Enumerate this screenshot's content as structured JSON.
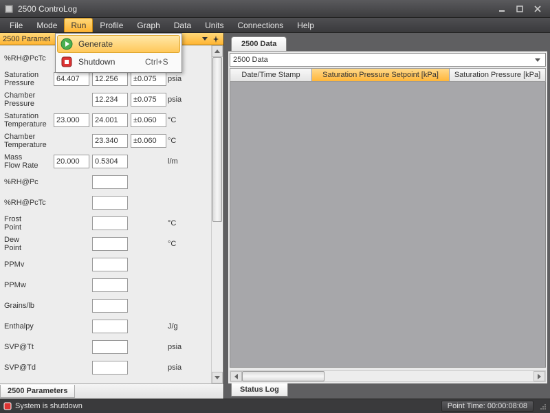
{
  "window": {
    "title": "2500 ControLog"
  },
  "menu": {
    "items": [
      "File",
      "Mode",
      "Run",
      "Profile",
      "Graph",
      "Data",
      "Units",
      "Connections",
      "Help"
    ],
    "active_index": 2
  },
  "run_menu": {
    "items": [
      {
        "icon": "play-icon",
        "label": "Generate",
        "shortcut": ""
      },
      {
        "icon": "stop-icon",
        "label": "Shutdown",
        "shortcut": "Ctrl+S"
      }
    ],
    "hover_index": 0
  },
  "left_panel": {
    "title": "2500 Paramet",
    "footer_tab": "2500 Parameters",
    "rows": [
      {
        "label": "%RH@PcTc",
        "v1": "",
        "v2": "",
        "v3": "",
        "unit": ""
      },
      {
        "label": "Saturation Pressure",
        "v1": "64.407",
        "v2": "12.256",
        "v3": "±0.075",
        "unit": "psia"
      },
      {
        "label": "Chamber Pressure",
        "v1": "",
        "v2": "12.234",
        "v3": "±0.075",
        "unit": "psia"
      },
      {
        "label": "Saturation Temperature",
        "v1": "23.000",
        "v2": "24.001",
        "v3": "±0.060",
        "unit": "°C"
      },
      {
        "label": "Chamber Temperature",
        "v1": "",
        "v2": "23.340",
        "v3": "±0.060",
        "unit": "°C"
      },
      {
        "label": "Mass Flow Rate",
        "v1": "20.000",
        "v2": "0.5304",
        "v3": "",
        "unit": "l/m"
      },
      {
        "label": "%RH@Pc",
        "v1": "",
        "v2": "",
        "v3": "",
        "unit": ""
      },
      {
        "label": "%RH@PcTc",
        "v1": "",
        "v2": "",
        "v3": "",
        "unit": ""
      },
      {
        "label": "Frost Point",
        "v1": "",
        "v2": "",
        "v3": "",
        "unit": "°C"
      },
      {
        "label": "Dew Point",
        "v1": "",
        "v2": "",
        "v3": "",
        "unit": "°C"
      },
      {
        "label": "PPMv",
        "v1": "",
        "v2": "",
        "v3": "",
        "unit": ""
      },
      {
        "label": "PPMw",
        "v1": "",
        "v2": "",
        "v3": "",
        "unit": ""
      },
      {
        "label": "Grains/lb",
        "v1": "",
        "v2": "",
        "v3": "",
        "unit": ""
      },
      {
        "label": "Enthalpy",
        "v1": "",
        "v2": "",
        "v3": "",
        "unit": "J/g"
      },
      {
        "label": "SVP@Tt",
        "v1": "",
        "v2": "",
        "v3": "",
        "unit": "psia"
      },
      {
        "label": "SVP@Td",
        "v1": "",
        "v2": "",
        "v3": "",
        "unit": "psia"
      }
    ]
  },
  "right_panel": {
    "tab": "2500 Data",
    "combo_selected": "2500 Data",
    "columns": [
      "Date/Time Stamp",
      "Saturation Pressure Setpoint [kPa]",
      "Saturation Pressure [kPa]"
    ],
    "active_col_index": 1,
    "status_log_tab": "Status Log"
  },
  "statusbar": {
    "text": "System is shutdown",
    "point_time_label": "Point Time:",
    "point_time_value": "00:00:08:08"
  }
}
